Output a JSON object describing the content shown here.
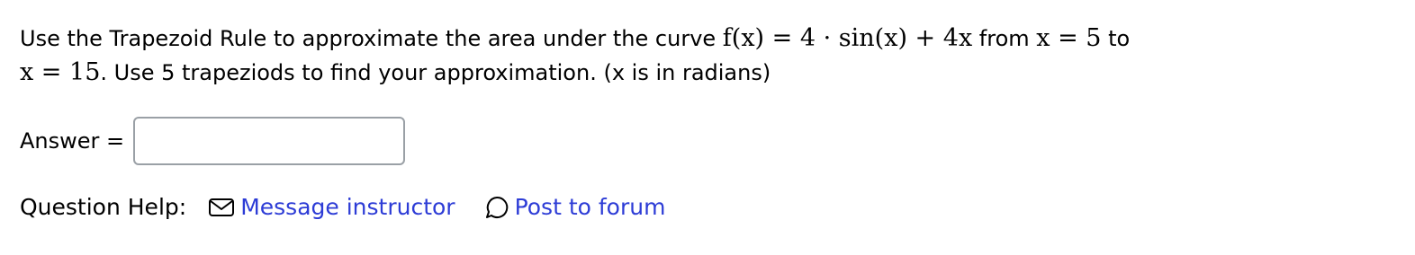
{
  "question": {
    "text_1": "Use the Trapezoid Rule to approximate the area under the curve ",
    "formula": "f(x) = 4 · sin(x) + 4x",
    "text_2": " from ",
    "from_expr": "x = 5",
    "text_3": " to",
    "to_expr": "x = 15",
    "text_4": ". Use 5 trapeziods to find your approximation. (x is in radians)"
  },
  "answer": {
    "label": "Answer =",
    "value": "",
    "placeholder": ""
  },
  "help": {
    "label": "Question Help:",
    "message_label": "Message instructor",
    "message_icon": "envelope-icon",
    "forum_label": "Post to forum",
    "forum_icon": "speech-bubble-icon",
    "link_color": "#2d3cd6"
  }
}
